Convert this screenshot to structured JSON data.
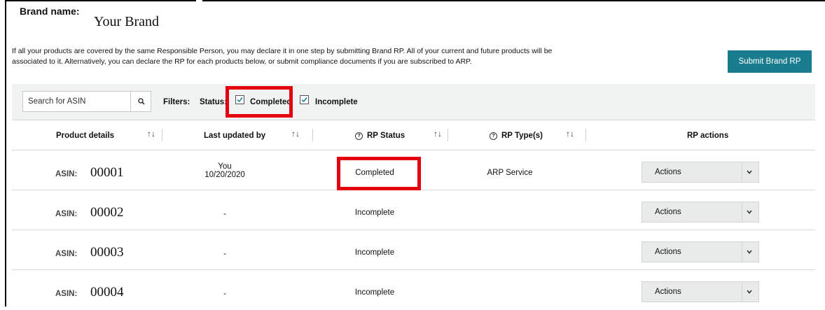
{
  "brand": {
    "label": "Brand name:",
    "value": "Your Brand"
  },
  "intro": {
    "line1": "If all your products are covered by the same Responsible Person, you may declare it in one step by submitting Brand RP. All of your current and future products will be",
    "line2": "associated to it. Alternatively, you can declare the RP for each products below, or submit compliance documents if you are subscribed to ARP."
  },
  "submit_button": "Submit Brand RP",
  "search": {
    "placeholder": "Search for ASIN",
    "value": ""
  },
  "filters": {
    "label": "Filters:",
    "status_label": "Status:",
    "options": [
      {
        "label": "Completed",
        "checked": true
      },
      {
        "label": "Incomplete",
        "checked": true
      }
    ]
  },
  "table": {
    "headers": [
      "Product details",
      "Last updated by",
      "RP Status",
      "RP Type(s)",
      "RP actions"
    ],
    "rows": [
      {
        "asin_label": "ASIN:",
        "asin": "00001",
        "updated_by": "You",
        "updated_date": "10/20/2020",
        "status": "Completed",
        "type": "ARP Service",
        "action": "Actions"
      },
      {
        "asin_label": "ASIN:",
        "asin": "00002",
        "updated_by": "-",
        "updated_date": "",
        "status": "Incomplete",
        "type": "",
        "action": "Actions"
      },
      {
        "asin_label": "ASIN:",
        "asin": "00003",
        "updated_by": "-",
        "updated_date": "",
        "status": "Incomplete",
        "type": "",
        "action": "Actions"
      },
      {
        "asin_label": "ASIN:",
        "asin": "00004",
        "updated_by": "-",
        "updated_date": "",
        "status": "Incomplete",
        "type": "",
        "action": "Actions"
      }
    ]
  },
  "colors": {
    "accent": "#1a7d8f",
    "highlight": "#e3000f",
    "filter_bg": "#f1f2f2"
  },
  "icons": [
    "search-icon",
    "checkbox-checked-icon",
    "sort-icon",
    "help-circle-icon",
    "chevron-down-icon"
  ]
}
